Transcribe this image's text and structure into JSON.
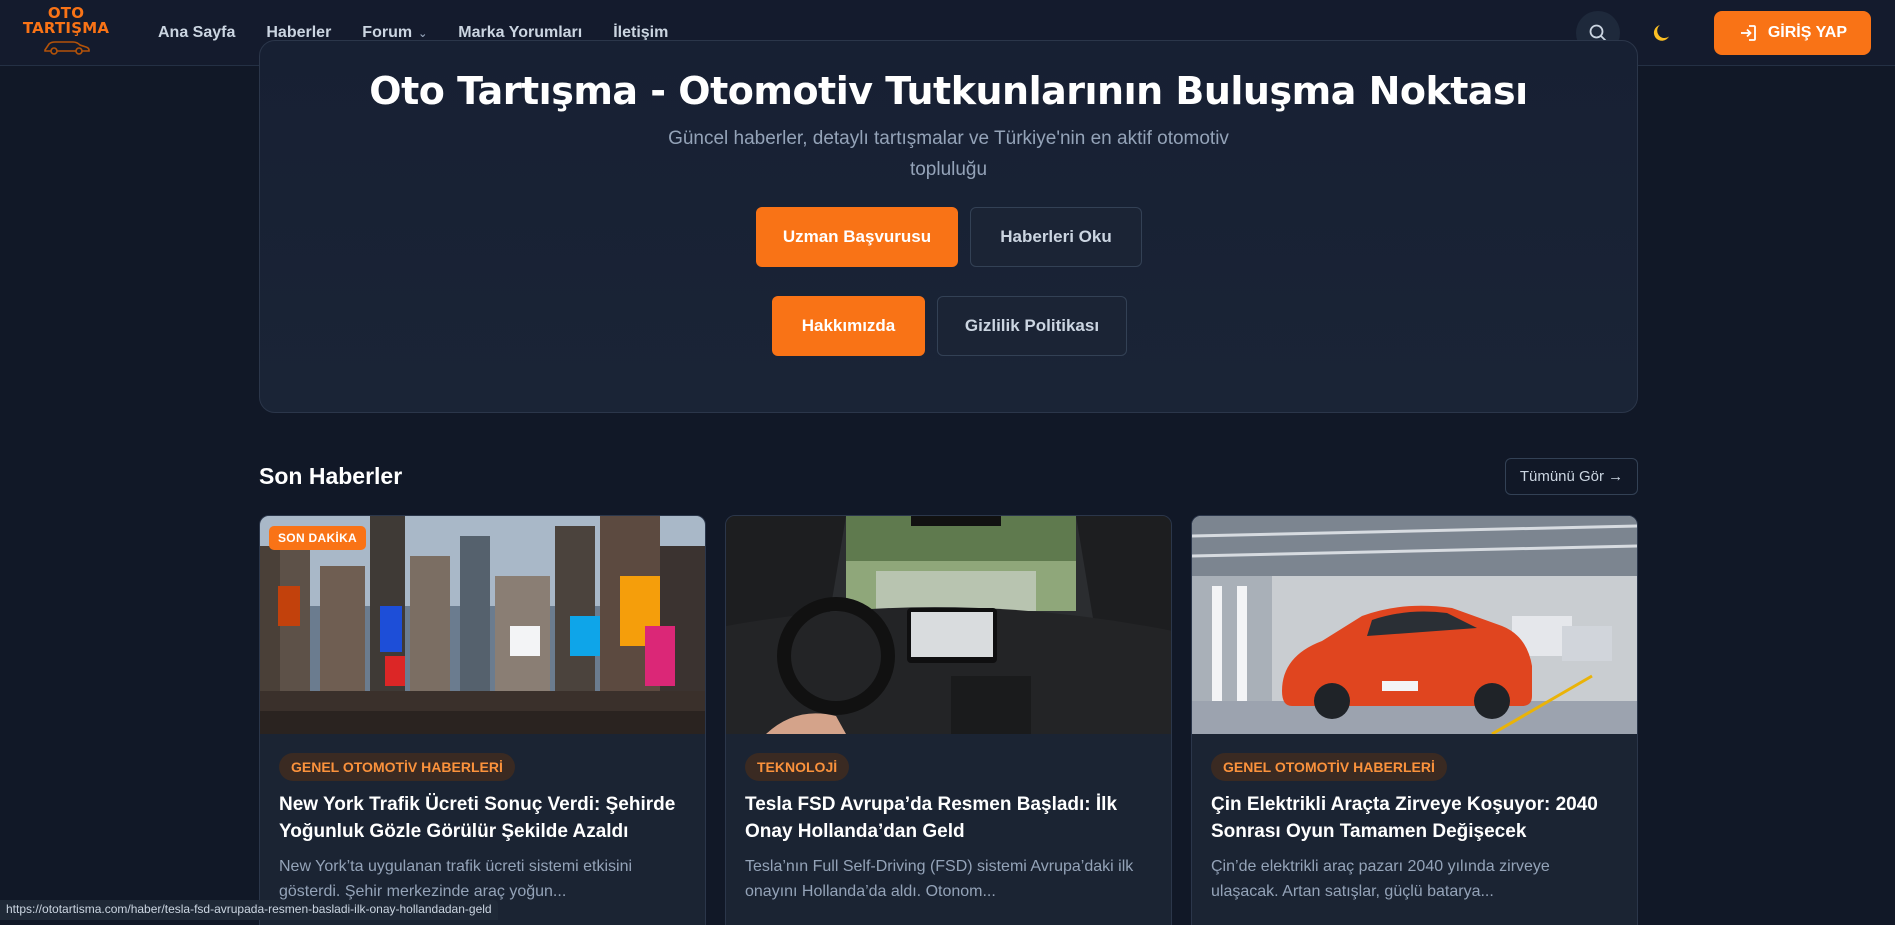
{
  "nav": {
    "logo_line1": "OTO",
    "logo_line2": "TARTIŞMA",
    "links": [
      {
        "label": "Ana Sayfa"
      },
      {
        "label": "Haberler"
      },
      {
        "label": "Forum"
      },
      {
        "label": "Marka Yorumları"
      },
      {
        "label": "İletişim"
      }
    ],
    "login_label": "GİRİŞ YAP",
    "search_icon": "search-icon",
    "theme_icon": "moon-icon",
    "accent_color": "#f97316"
  },
  "hero": {
    "title": "Oto Tartışma - Otomotiv Tutkunlarının Buluşma Noktası",
    "subtitle": "Güncel haberler, detaylı tartışmalar ve Türkiye'nin en aktif otomotiv topluluğu",
    "btn_expert": "Uzman Başvurusu",
    "btn_news": "Haberleri Oku",
    "btn_about": "Hakkımızda",
    "btn_privacy": "Gizlilik Politikası"
  },
  "latest": {
    "title": "Son Haberler",
    "see_all": "Tümünü Gör →",
    "cards": [
      {
        "badge": "SON DAKİKA",
        "category": "GENEL OTOMOTİV HABERLERİ",
        "title": "New York Trafik Ücreti Sonuç Verdi: Şehirde Yoğunluk Gözle Görülür Şekilde Azaldı",
        "desc": "New York’ta uygulanan trafik ücreti sistemi etkisini gösterdi. Şehir merkezinde araç yoğun..."
      },
      {
        "category": "TEKNOLOJİ",
        "title": "Tesla FSD Avrupa’da Resmen Başladı: İlk Onay Hollanda’dan Geld",
        "desc": "Tesla’nın Full Self-Driving (FSD) sistemi Avrupa’daki ilk onayını Hollanda’da aldı. Otonom..."
      },
      {
        "category": "GENEL OTOMOTİV HABERLERİ",
        "title": "Çin Elektrikli Araçta Zirveye Koşuyor: 2040 Sonrası Oyun Tamamen Değişecek",
        "desc": "Çin’de elektrikli araç pazarı 2040 yılında zirveye ulaşacak. Artan satışlar, güçlü batarya..."
      }
    ]
  },
  "status_url": "https://ototartisma.com/haber/tesla-fsd-avrupada-resmen-basladi-ilk-onay-hollandadan-geld"
}
